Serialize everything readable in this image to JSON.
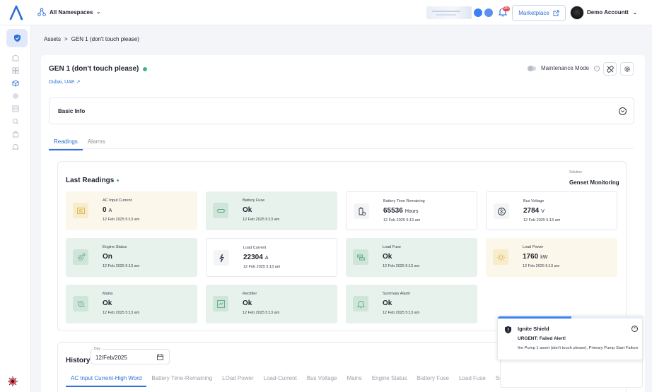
{
  "topbar": {
    "namespace": "All Namespaces",
    "marketplace": "Marketplace",
    "notifications_badge": "99+",
    "account": "Demo Accountt"
  },
  "breadcrumb": {
    "root": "Assets",
    "sep": ">",
    "current": "GEN 1 (don't touch please)"
  },
  "asset": {
    "title": "GEN 1 (don't touch please)",
    "location": "Dubai, UAE",
    "maintenance_label": "Maintenance Mode",
    "status_color": "#3db87c"
  },
  "basic_info": {
    "label": "Basic Info"
  },
  "tabs": [
    "Readings",
    "Alarms"
  ],
  "readings": {
    "title": "Last Readings",
    "solution_label": "Solution",
    "solution_value": "Genset Monitoring",
    "cards": [
      {
        "label": "AC Input Current",
        "value": "0",
        "unit": "A",
        "time": "12 Feb 2025 5:13 am",
        "style": "yellow",
        "icon": "input-current-icon"
      },
      {
        "label": "Battery Fuse",
        "value": "Ok",
        "unit": "",
        "time": "12 Feb 2025 5:13 am",
        "style": "green",
        "icon": "fuse-icon"
      },
      {
        "label": "Battery Time Remaining",
        "value": "65536",
        "unit": "Hours",
        "time": "12 Feb 2025 5:13 am",
        "style": "white",
        "icon": "battery-clock-icon"
      },
      {
        "label": "Bus Voltage",
        "value": "2784",
        "unit": "V",
        "time": "12 Feb 2025 5:13 am",
        "style": "white",
        "icon": "voltage-gauge-icon"
      },
      {
        "label": "Engine Status",
        "value": "On",
        "unit": "",
        "time": "12 Feb 2025 5:13 am",
        "style": "green",
        "icon": "engine-gear-icon"
      },
      {
        "label": "Load Current",
        "value": "22304",
        "unit": "A",
        "time": "12 Feb 2025 5:13 am",
        "style": "white",
        "icon": "lightning-icon"
      },
      {
        "label": "Load Fuse",
        "value": "Ok",
        "unit": "",
        "time": "12 Feb 2025 5:13 am",
        "style": "green",
        "icon": "load-fuse-icon"
      },
      {
        "label": "Load Power",
        "value": "1760",
        "unit": "kW",
        "time": "12 Feb 2025 5:13 am",
        "style": "yellow",
        "icon": "power-bulb-icon"
      },
      {
        "label": "Mains",
        "value": "Ok",
        "unit": "",
        "time": "12 Feb 2025 5:13 am",
        "style": "green",
        "icon": "mains-icon"
      },
      {
        "label": "Rectifier",
        "value": "Ok",
        "unit": "",
        "time": "12 Feb 2025 5:13 am",
        "style": "green",
        "icon": "rectifier-icon"
      },
      {
        "label": "Summary Alarm",
        "value": "Ok",
        "unit": "",
        "time": "12 Feb 2025 5:13 am",
        "style": "green",
        "icon": "alarm-bell-icon"
      }
    ]
  },
  "history": {
    "title": "History",
    "day_label": "Day",
    "day_value": "12/Feb/2025",
    "tabs": [
      "AC Input Current-High Word",
      "Battery Time-Remaining",
      "LOad Power",
      "Load-Current",
      "Bus Voltage",
      "Mains",
      "Engine Status",
      "Battery Fuse",
      "Load Fuse",
      "Summ"
    ]
  },
  "toast": {
    "title": "Ignite Shield",
    "headline": "URGENT: Failed Alert!",
    "message": "fire Pump 1 asset (don't touch please), Primary Pump Start Failure",
    "progress": 0.51
  }
}
